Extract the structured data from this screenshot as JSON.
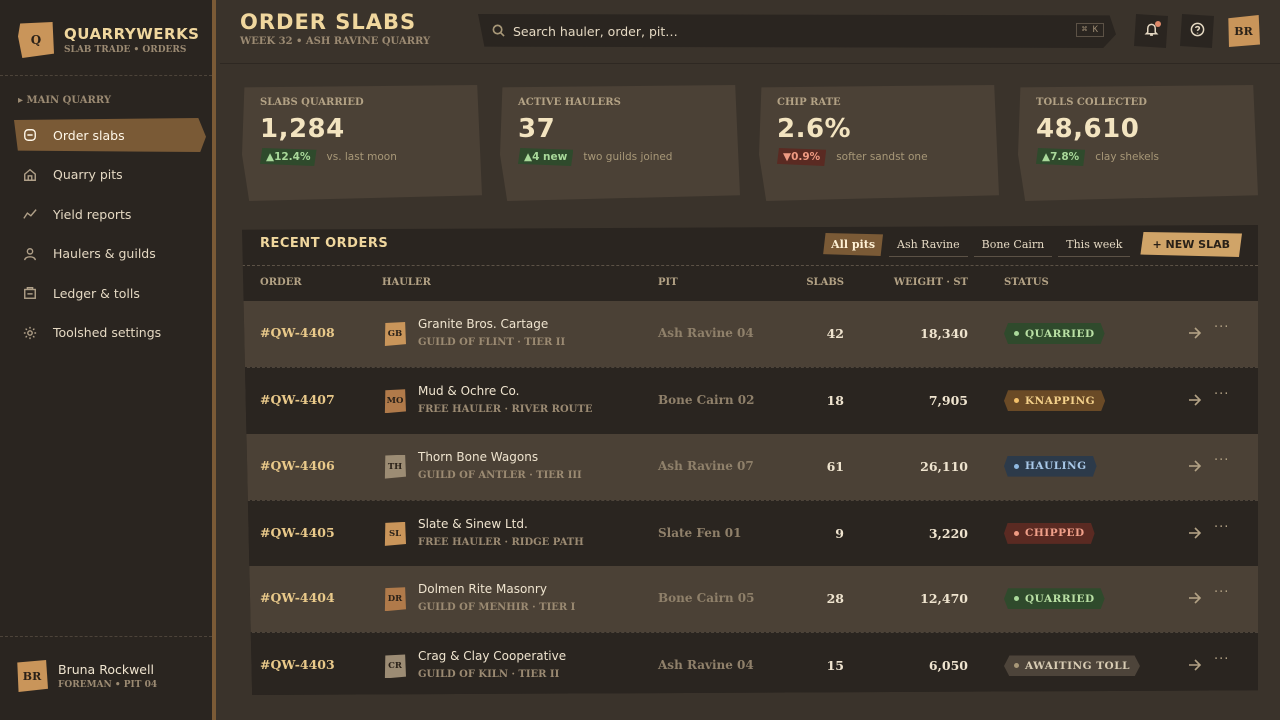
{
  "brand": {
    "logo_letter": "Q",
    "name": "QUARRYWERKS",
    "subtitle": "SLAB TRADE • ORDERS"
  },
  "sidebar": {
    "section_label": "▸ MAIN QUARRY",
    "items": [
      {
        "label": "Order slabs",
        "icon": "slab-icon",
        "active": true
      },
      {
        "label": "Quarry pits",
        "icon": "home-icon",
        "active": false
      },
      {
        "label": "Yield reports",
        "icon": "trend-icon",
        "active": false
      },
      {
        "label": "Haulers & guilds",
        "icon": "user-icon",
        "active": false
      },
      {
        "label": "Ledger & tolls",
        "icon": "ledger-icon",
        "active": false
      },
      {
        "label": "Toolshed settings",
        "icon": "gear-icon",
        "active": false
      }
    ],
    "user": {
      "initials": "BR",
      "name": "Bruna Rockwell",
      "role": "FOREMAN • PIT 04"
    }
  },
  "header": {
    "title": "ORDER SLABS",
    "subtitle": "WEEK 32 • ASH RAVINE QUARRY",
    "search_placeholder": "Search hauler, order, pit…",
    "shortcut": "⌘ K",
    "avatar_initials": "BR"
  },
  "stats": [
    {
      "label": "SLABS QUARRIED",
      "value": "1,284",
      "delta": "▲12.4%",
      "direction": "up",
      "note": "vs. last moon"
    },
    {
      "label": "ACTIVE HAULERS",
      "value": "37",
      "delta": "▲4 new",
      "direction": "up",
      "note": "two guilds joined"
    },
    {
      "label": "CHIP RATE",
      "value": "2.6%",
      "delta": "▼0.9%",
      "direction": "down",
      "note": "softer sandst one"
    },
    {
      "label": "TOLLS COLLECTED",
      "value": "48,610",
      "delta": "▲7.8%",
      "direction": "up",
      "note": "clay shekels"
    }
  ],
  "orders": {
    "title": "RECENT ORDERS",
    "filters": [
      "All pits",
      "Ash Ravine",
      "Bone Cairn",
      "This week"
    ],
    "active_filter": "All pits",
    "new_button": "+ NEW SLAB",
    "columns": [
      "ORDER",
      "HAULER",
      "PIT",
      "SLABS",
      "WEIGHT · ST",
      "STATUS"
    ],
    "rows": [
      {
        "id": "#QW-4408",
        "initials": "GB",
        "av_color": "#c9955a",
        "hauler": "Granite Bros. Cartage",
        "guild": "GUILD OF FLINT · TIER II",
        "pit": "Ash Ravine 04",
        "slabs": "42",
        "weight": "18,340",
        "status": "QUARRIED",
        "status_kind": "quarried"
      },
      {
        "id": "#QW-4407",
        "initials": "MO",
        "av_color": "#b07a4a",
        "hauler": "Mud & Ochre Co.",
        "guild": "FREE HAULER · RIVER ROUTE",
        "pit": "Bone Cairn 02",
        "slabs": "18",
        "weight": "7,905",
        "status": "KNAPPING",
        "status_kind": "knapping"
      },
      {
        "id": "#QW-4406",
        "initials": "TH",
        "av_color": "#9c8c74",
        "hauler": "Thorn Bone Wagons",
        "guild": "GUILD OF ANTLER · TIER III",
        "pit": "Ash Ravine 07",
        "slabs": "61",
        "weight": "26,110",
        "status": "HAULING",
        "status_kind": "hauling"
      },
      {
        "id": "#QW-4405",
        "initials": "SL",
        "av_color": "#c9955a",
        "hauler": "Slate & Sinew Ltd.",
        "guild": "FREE HAULER · RIDGE PATH",
        "pit": "Slate Fen 01",
        "slabs": "9",
        "weight": "3,220",
        "status": "CHIPPED",
        "status_kind": "chipped"
      },
      {
        "id": "#QW-4404",
        "initials": "DR",
        "av_color": "#b07a4a",
        "hauler": "Dolmen Rite Masonry",
        "guild": "GUILD OF MENHIR · TIER I",
        "pit": "Bone Cairn 05",
        "slabs": "28",
        "weight": "12,470",
        "status": "QUARRIED",
        "status_kind": "quarried"
      },
      {
        "id": "#QW-4403",
        "initials": "CR",
        "av_color": "#9c8c74",
        "hauler": "Crag & Clay Cooperative",
        "guild": "GUILD OF KILN · TIER II",
        "pit": "Ash Ravine 04",
        "slabs": "15",
        "weight": "6,050",
        "status": "AWAITING TOLL",
        "status_kind": "awaiting"
      }
    ]
  },
  "colors": {
    "accent": "#7a5a36",
    "gold": "#f0d79e",
    "status": {
      "quarried": {
        "bg": "#2f4a2c",
        "fg": "#b9e0a4",
        "dot": "#a9d99a"
      },
      "knapping": {
        "bg": "#6a4a26",
        "fg": "#f3d08a",
        "dot": "#f3c06a"
      },
      "hauling": {
        "bg": "#2c3a4a",
        "fg": "#a8c8e8",
        "dot": "#8fb8e0"
      },
      "chipped": {
        "bg": "#5a2a22",
        "fg": "#f0a08a",
        "dot": "#ef9a82"
      },
      "awaiting": {
        "bg": "#4d443a",
        "fg": "#d8ccb4",
        "dot": "#a89878"
      }
    }
  }
}
